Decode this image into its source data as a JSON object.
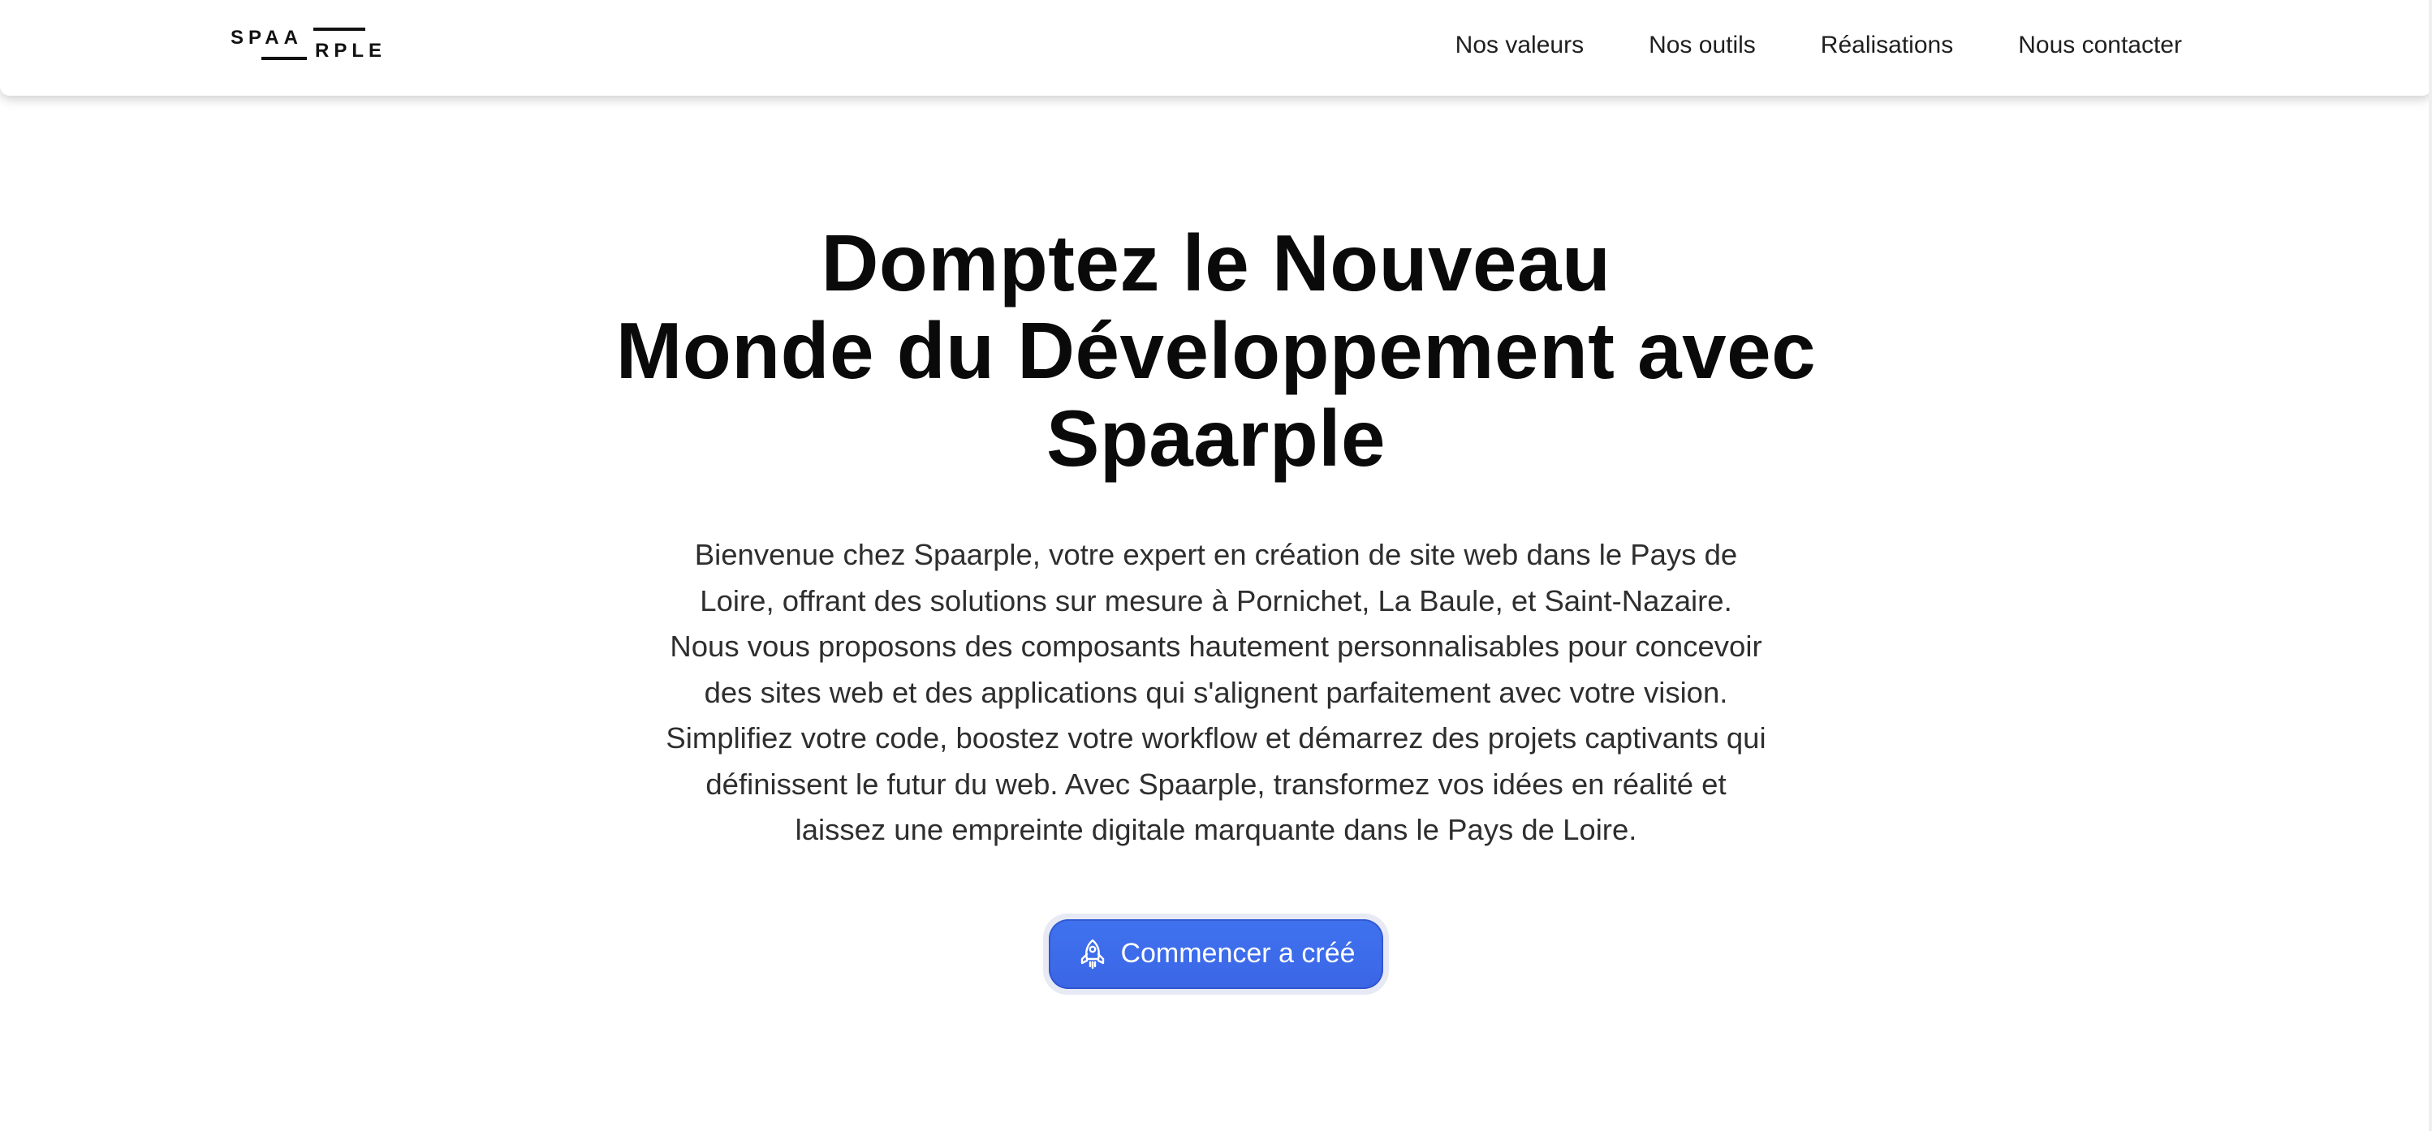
{
  "brand": {
    "logo_text": "SPAARPLE",
    "logo_top": "SPAA",
    "logo_bottom": "RPLE"
  },
  "nav": {
    "items": [
      {
        "label": "Nos valeurs"
      },
      {
        "label": "Nos outils"
      },
      {
        "label": "Réalisations"
      },
      {
        "label": "Nous contacter"
      }
    ]
  },
  "hero": {
    "title_lines": [
      "Domptez le Nouveau",
      "Monde du Développement avec",
      "Spaarple"
    ],
    "description": "Bienvenue chez Spaarple, votre expert en création de site web dans le Pays de Loire, offrant des solutions sur mesure à Pornichet, La Baule, et Saint-Nazaire. Nous vous proposons des composants hautement personnalisables pour concevoir des sites web et des applications qui s'alignent parfaitement avec votre vision. Simplifiez votre code, boostez votre workflow et démarrez des projets captivants qui définissent le futur du web. Avec Spaarple, transformez vos idées en réalité et laissez une empreinte digitale marquante dans le Pays de Loire.",
    "cta_label": "Commencer a créé",
    "cta_icon": "rocket-icon"
  },
  "colors": {
    "cta_background": "#3f72ef",
    "cta_text": "#ffffff",
    "title_text": "#0a0a0a",
    "body_text": "#2e2e2e"
  }
}
